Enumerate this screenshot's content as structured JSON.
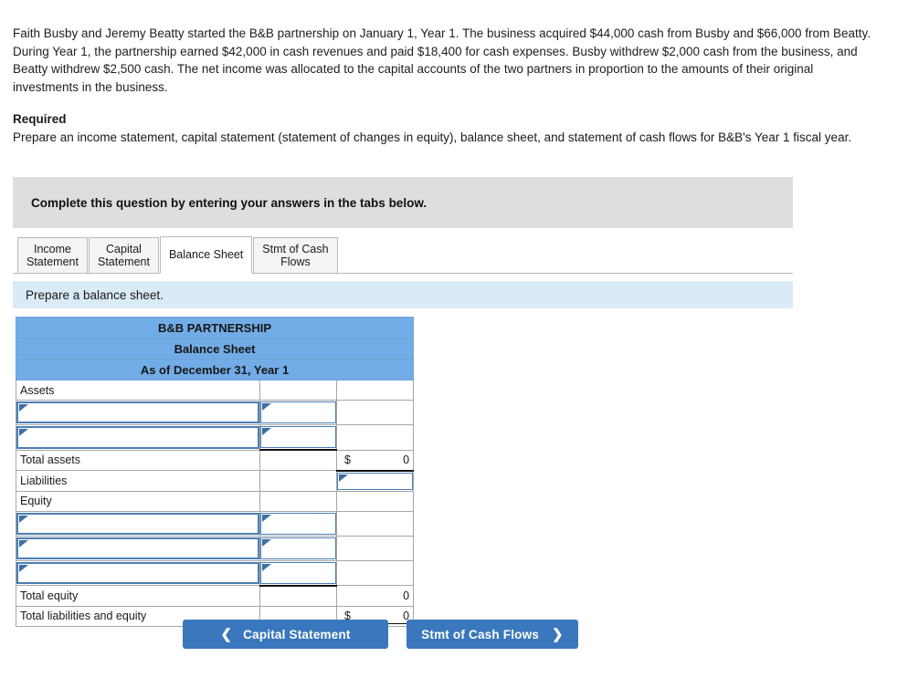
{
  "problem": {
    "text": "Faith Busby and Jeremy Beatty started the B&B partnership on January 1, Year 1. The business acquired $44,000 cash from Busby and $66,000 from Beatty. During Year 1, the partnership earned $42,000 in cash revenues and paid $18,400 for cash expenses. Busby withdrew $2,000 cash from the business, and Beatty withdrew $2,500 cash. The net income was allocated to the capital accounts of the two partners in proportion to the amounts of their original investments in the business."
  },
  "required": {
    "title": "Required",
    "text": "Prepare an income statement, capital statement (statement of changes in equity), balance sheet, and statement of cash flows for B&B's Year 1 fiscal year."
  },
  "instruction_banner": {
    "text": "Complete this question by entering your answers in the tabs below."
  },
  "tabs": [
    {
      "label": "Income\nStatement",
      "active": false
    },
    {
      "label": "Capital\nStatement",
      "active": false
    },
    {
      "label": "Balance Sheet",
      "active": true
    },
    {
      "label": "Stmt of Cash\nFlows",
      "active": false
    }
  ],
  "sub_instruction": {
    "text": "Prepare a balance sheet."
  },
  "statement": {
    "header": {
      "company": "B&B PARTNERSHIP",
      "title": "Balance Sheet",
      "period": "As of December 31, Year 1"
    },
    "rows": [
      {
        "label": "Assets",
        "mid": "",
        "right": ""
      },
      {
        "label": "",
        "mid": "",
        "right": ""
      },
      {
        "label": "",
        "mid": "",
        "right": ""
      },
      {
        "label": "Total assets",
        "mid": "",
        "right": "0",
        "right_dollar": "$"
      },
      {
        "label": "Liabilities",
        "mid": "",
        "right": ""
      },
      {
        "label": "Equity",
        "mid": "",
        "right": ""
      },
      {
        "label": "",
        "mid": "",
        "right": ""
      },
      {
        "label": "",
        "mid": "",
        "right": ""
      },
      {
        "label": "",
        "mid": "",
        "right": ""
      },
      {
        "label": "Total equity",
        "mid": "",
        "right": "0"
      },
      {
        "label": "Total liabilities and equity",
        "mid": "",
        "right": "0",
        "right_dollar": "$"
      }
    ]
  },
  "navigation": {
    "prev_label": "Capital Statement",
    "prev_icon": "chevron-left-icon",
    "next_label": "Stmt of Cash Flows",
    "next_icon": "chevron-right-icon"
  },
  "colors": {
    "header_blue": "#72ace6",
    "banner_gray": "#dedede",
    "sub_instruction_blue": "#dbeaf7",
    "button_blue": "#3a77bc",
    "input_border_blue": "#4a7fb5"
  }
}
